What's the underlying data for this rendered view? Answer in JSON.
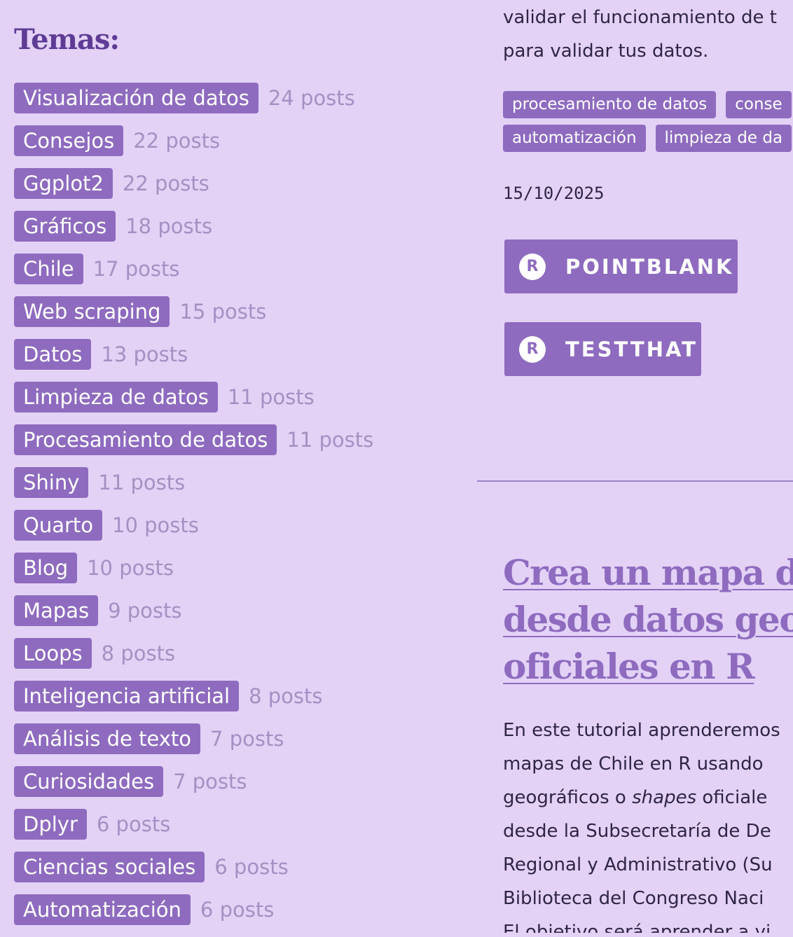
{
  "sidebar": {
    "title": "Temas:",
    "tags": [
      {
        "label": "Visualización de datos",
        "count": "24 posts"
      },
      {
        "label": "Consejos",
        "count": "22 posts"
      },
      {
        "label": "Ggplot2",
        "count": "22 posts"
      },
      {
        "label": "Gráficos",
        "count": "18 posts"
      },
      {
        "label": "Chile",
        "count": "17 posts"
      },
      {
        "label": "Web scraping",
        "count": "15 posts"
      },
      {
        "label": "Datos",
        "count": "13 posts"
      },
      {
        "label": "Limpieza de datos",
        "count": "11 posts"
      },
      {
        "label": "Procesamiento de datos",
        "count": "11 posts"
      },
      {
        "label": "Shiny",
        "count": "11 posts"
      },
      {
        "label": "Quarto",
        "count": "10 posts"
      },
      {
        "label": "Blog",
        "count": "10 posts"
      },
      {
        "label": "Mapas",
        "count": "9 posts"
      },
      {
        "label": "Loops",
        "count": "8 posts"
      },
      {
        "label": "Inteligencia artificial",
        "count": "8 posts"
      },
      {
        "label": "Análisis de texto",
        "count": "7 posts"
      },
      {
        "label": "Curiosidades",
        "count": "7 posts"
      },
      {
        "label": "Dplyr",
        "count": "6 posts"
      },
      {
        "label": "Ciencias sociales",
        "count": "6 posts"
      },
      {
        "label": "Automatización",
        "count": "6 posts"
      }
    ]
  },
  "previous_post": {
    "text_lines": [
      "validar el funcionamiento de t",
      "para validar tus datos."
    ],
    "tag_rows": [
      [
        "procesamiento de datos",
        "conse"
      ],
      [
        "automatización",
        "limpieza de da"
      ]
    ],
    "date": "15/10/2025",
    "packages": [
      {
        "label": "POINTBLANK",
        "icon": "r-logo-icon"
      },
      {
        "label": "TESTTHAT",
        "icon": "r-logo-icon"
      }
    ]
  },
  "next_post": {
    "title_lines": [
      "Crea un mapa de C",
      "desde datos geoesp",
      "oficiales en R"
    ],
    "summary_lines": [
      {
        "before": "En este tutorial aprenderemos",
        "em": "",
        "after": ""
      },
      {
        "before": "mapas de Chile en R usando ",
        "em": "",
        "after": ""
      },
      {
        "before": "geográficos o ",
        "em": "shapes",
        "after": " oficiale"
      },
      {
        "before": "desde la Subsecretaría de De",
        "em": "",
        "after": ""
      },
      {
        "before": "Regional y Administrativo (Su",
        "em": "",
        "after": ""
      },
      {
        "before": "Biblioteca del Congreso Naci",
        "em": "",
        "after": ""
      },
      {
        "before": "El objetivo será aprender a vi",
        "em": "",
        "after": ""
      }
    ]
  },
  "colors": {
    "background": "#e3d2f6",
    "accent": "#8e6bbf",
    "heading": "#5e3c95",
    "count_text": "#a590c3"
  }
}
